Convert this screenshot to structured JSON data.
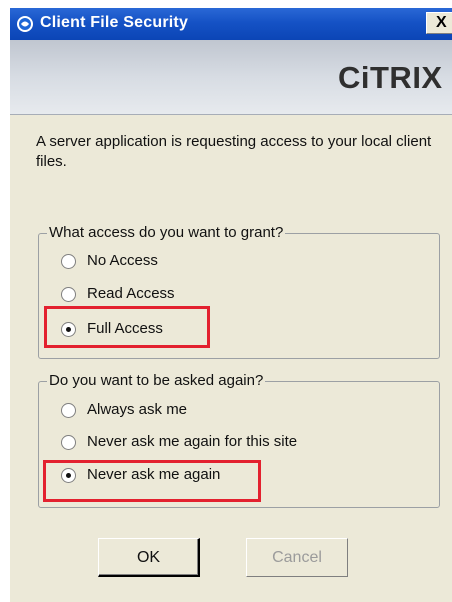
{
  "window": {
    "title": "Client File Security",
    "close_label": "X"
  },
  "banner": {
    "brand": "CiTRIX"
  },
  "message": {
    "text": "A server application is requesting access to your local client files."
  },
  "access_group": {
    "legend": "What access do you want to grant?",
    "options": [
      {
        "label": "No Access",
        "checked": false
      },
      {
        "label": "Read Access",
        "checked": false
      },
      {
        "label": "Full Access",
        "checked": true
      }
    ]
  },
  "ask_group": {
    "legend": "Do you want to be asked again?",
    "options": [
      {
        "label": "Always ask me",
        "checked": false
      },
      {
        "label": "Never ask me again for this site",
        "checked": false
      },
      {
        "label": "Never ask me again",
        "checked": true
      }
    ]
  },
  "buttons": {
    "ok": "OK",
    "cancel": "Cancel"
  },
  "colors": {
    "titlebar": "#0b45b6",
    "highlight": "#e3212f",
    "window_bg": "#ece9d8"
  },
  "icons": {
    "title": "citrix-app-icon",
    "close": "close-icon"
  }
}
